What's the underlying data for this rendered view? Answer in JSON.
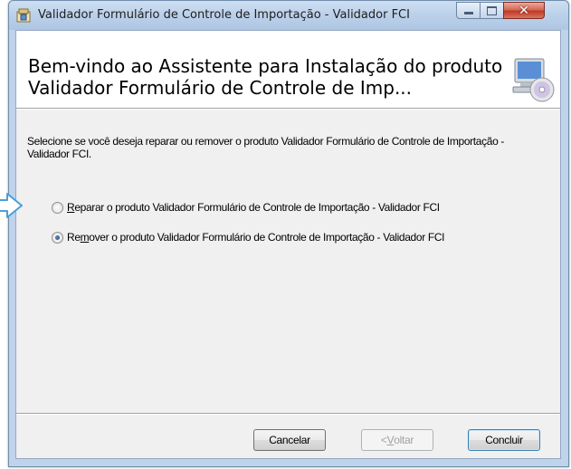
{
  "window": {
    "title": "Validador Formulário de Controle de Importação - Validador FCI",
    "controls": {
      "minimize": "minimize-icon",
      "maximize": "maximize-icon",
      "close": "close-icon"
    },
    "close_glyph": "✕"
  },
  "banner": {
    "title": "Bem-vindo ao Assistente para Instalação do produto Validador Formulário de Controle de Imp...",
    "icon": "computer-cd-icon"
  },
  "instructions": "Selecione se você deseja reparar ou remover o produto Validador Formulário de Controle de Importação - Validador FCI.",
  "options": [
    {
      "prefix": "",
      "mnemonic": "R",
      "rest": "eparar o produto Validador Formulário de Controle de Importação - Validador FCI",
      "selected": false
    },
    {
      "prefix": "Re",
      "mnemonic": "m",
      "rest": "over o produto Validador Formulário de Controle de Importação - Validador FCI",
      "selected": true
    }
  ],
  "buttons": {
    "cancel": "Cancelar",
    "back": {
      "prefix": "< ",
      "mnemonic": "V",
      "rest": "oltar",
      "enabled": false
    },
    "finish": "Concluir"
  },
  "annotation": {
    "icon": "arrow-right-icon",
    "color": "#4a9fd8"
  }
}
